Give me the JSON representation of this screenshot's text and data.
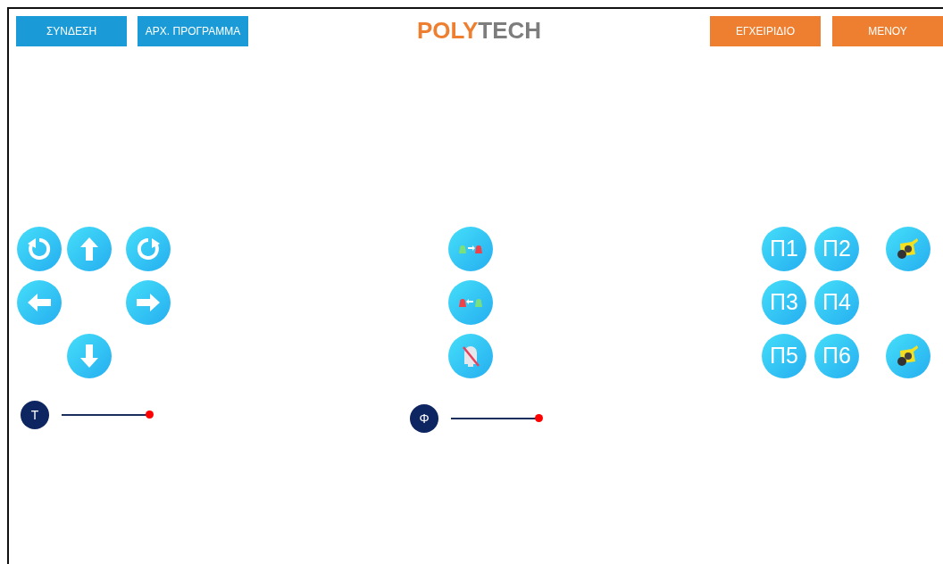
{
  "top_bar": {
    "left_buttons": [
      "ΣΥΝΔΕΣΗ",
      "ΑΡΧ. ΠΡΟΓΡΑΜΜΑ"
    ],
    "logo": {
      "accent": "POLY",
      "rest": "TECH"
    },
    "right_buttons": [
      "ΕΓΧΕΙΡΙΔΙΟ",
      "ΜΕΝΟΥ"
    ]
  },
  "presets": [
    "Π1",
    "Π2",
    "Π3",
    "Π4",
    "Π5",
    "Π6"
  ],
  "sliders": [
    {
      "label": "Τ",
      "level": 1
    },
    {
      "label": "Φ",
      "level": 1
    }
  ]
}
